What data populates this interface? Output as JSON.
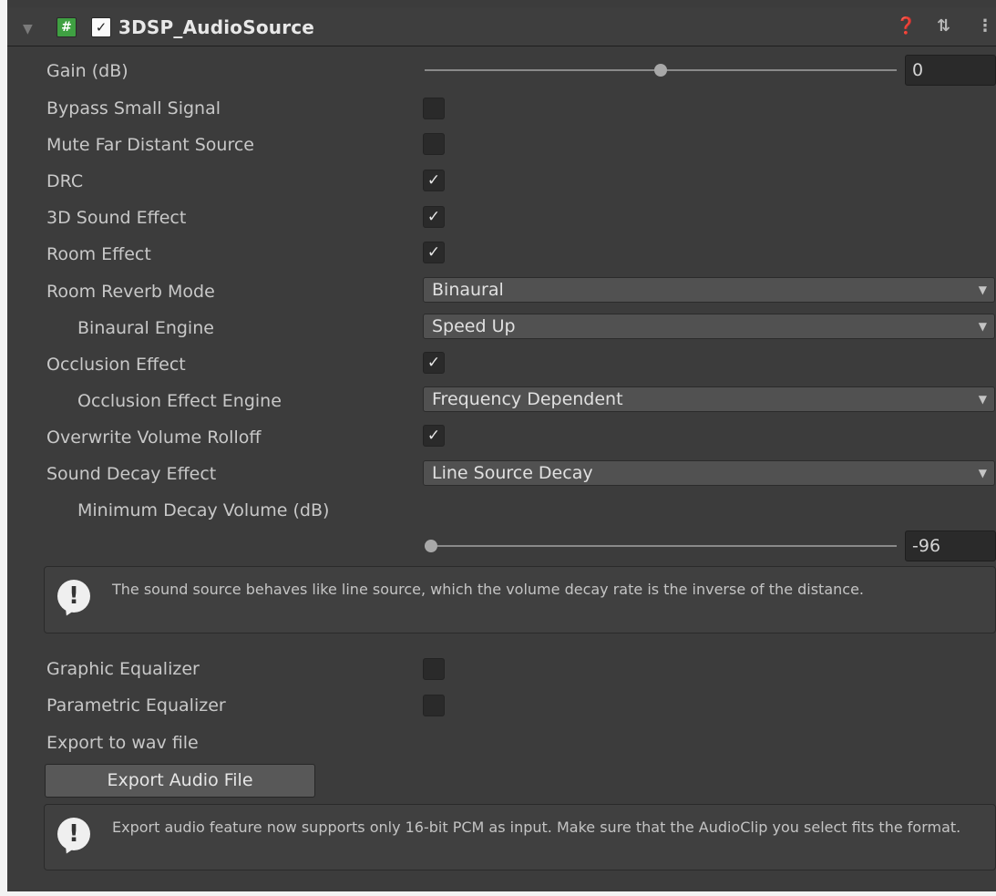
{
  "component": {
    "title": "3DSP_AudioSource",
    "enabled": true,
    "icons": [
      "foldout-arrow-icon",
      "script-icon",
      "help-icon",
      "preset-icon",
      "kebab-menu-icon"
    ]
  },
  "gain": {
    "label": "Gain (dB)",
    "value": "0",
    "slider_fraction": 0.5
  },
  "bypass": {
    "label": "Bypass Small Signal",
    "checked": false
  },
  "mute": {
    "label": "Mute Far Distant Source",
    "checked": false
  },
  "drc": {
    "label": "DRC",
    "checked": true
  },
  "sound3d": {
    "label": "3D Sound Effect",
    "checked": true
  },
  "room": {
    "label": "Room Effect",
    "checked": true
  },
  "reverb": {
    "label": "Room Reverb Mode",
    "value": "Binaural"
  },
  "binaural": {
    "label": "Binaural Engine",
    "value": "Speed Up"
  },
  "occlusion": {
    "label": "Occlusion Effect",
    "checked": true
  },
  "occlusion_engine": {
    "label": "Occlusion Effect Engine",
    "value": "Frequency Dependent"
  },
  "rolloff": {
    "label": "Overwrite Volume Rolloff",
    "checked": true
  },
  "decay": {
    "label": "Sound Decay Effect",
    "value": "Line Source Decay"
  },
  "min_decay": {
    "label": "Minimum Decay Volume (dB)",
    "value": "-96",
    "slider_fraction": 0.0
  },
  "decay_help": "The sound source behaves like line source, which the volume decay rate is the inverse of the distance.",
  "geq": {
    "label": "Graphic Equalizer",
    "checked": false
  },
  "peq": {
    "label": "Parametric Equalizer",
    "checked": false
  },
  "export": {
    "label": "Export to wav file",
    "button": "Export Audio File",
    "help": "Export audio feature now supports only 16-bit PCM as input. Make sure that the AudioClip you select fits the format."
  },
  "check_glyph": "✓",
  "colors": {
    "script_icon": "#3fa042",
    "panel_bg": "#3c3c3c",
    "field_bg": "#2a2a2a",
    "dropdown_bg": "#515151"
  }
}
